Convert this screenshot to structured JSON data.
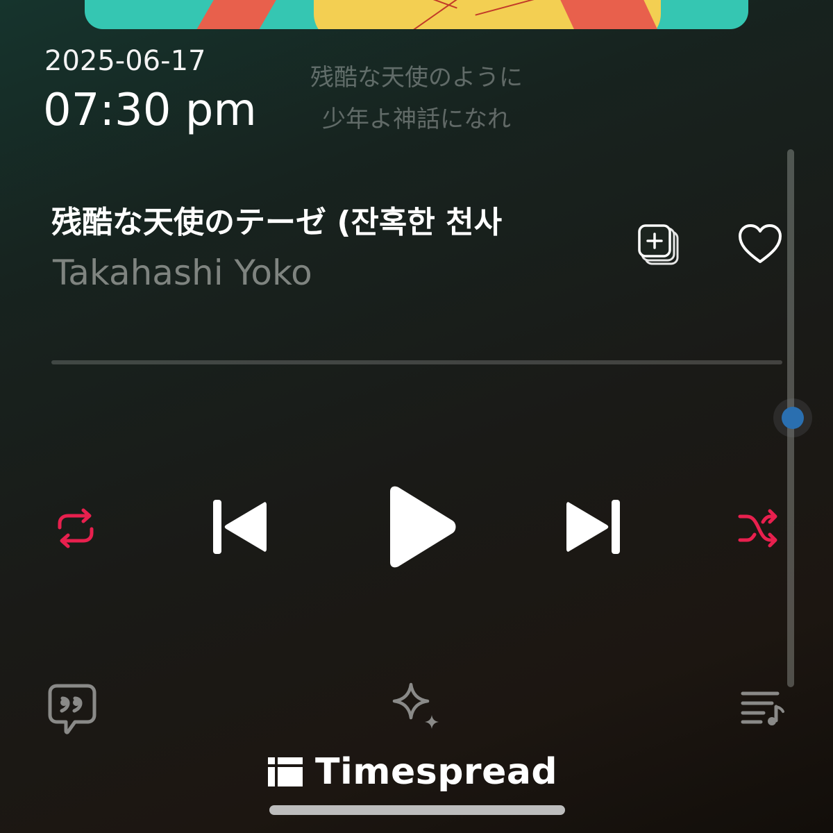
{
  "status": {
    "date": "2025-06-17",
    "time": "07:30 pm"
  },
  "lyrics": {
    "line1": "残酷な天使のように",
    "line2": "少年よ神話になれ"
  },
  "track": {
    "title": "残酷な天使のテーゼ (잔혹한 천사",
    "artist": "Takahashi Yoko"
  },
  "progress": {
    "fraction": 0.0
  },
  "volume": {
    "fraction": 0.5
  },
  "icons": {
    "add_to_playlist": "add-to-playlist-icon",
    "favorite": "heart-icon",
    "repeat": "repeat-icon",
    "previous": "skip-previous-icon",
    "play": "play-icon",
    "next": "skip-next-icon",
    "shuffle": "shuffle-icon",
    "lyrics": "lyrics-quote-icon",
    "ai": "sparkle-icon",
    "queue": "queue-icon"
  },
  "colors": {
    "accent": "#e8204e",
    "volume_thumb": "#2a6fb0"
  },
  "footer": {
    "brand": "Timespread"
  }
}
